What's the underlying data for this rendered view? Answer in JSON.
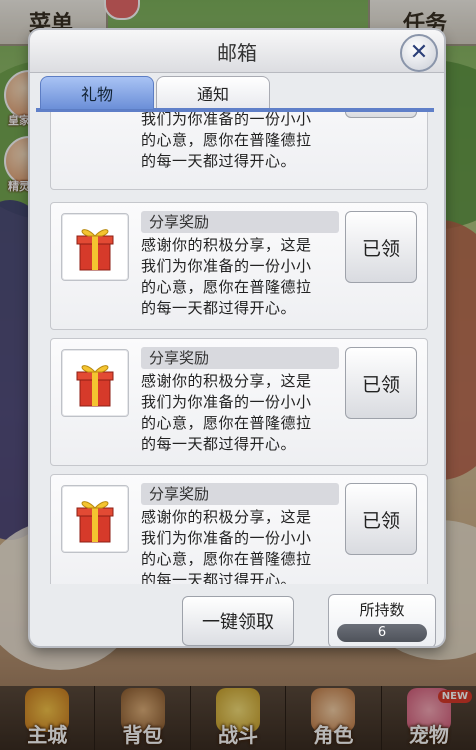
{
  "background": {
    "top_left_menu": "菜单",
    "top_right_task": "任务",
    "side_icons": [
      {
        "label": "皇家"
      },
      {
        "label": "精灵"
      }
    ],
    "bottom_nav": [
      {
        "label": "主城",
        "icon": "castle-icon"
      },
      {
        "label": "背包",
        "icon": "bag-icon"
      },
      {
        "label": "战斗",
        "icon": "battle-icon"
      },
      {
        "label": "角色",
        "icon": "character-icon"
      },
      {
        "label": "宠物",
        "icon": "pet-icon",
        "badge": "NEW"
      }
    ]
  },
  "mailbox": {
    "title": "邮箱",
    "tabs": [
      {
        "label": "礼物",
        "active": true
      },
      {
        "label": "通知",
        "active": false
      }
    ],
    "partial_item": {
      "body_lines": [
        "我们为你准备的一份小小",
        "的心意，愿你在普隆德拉",
        "的每一天都过得开心。"
      ]
    },
    "items": [
      {
        "title": "分享奖励",
        "body_lines": [
          "感谢你的积极分享，这是",
          "我们为你准备的一份小小",
          "的心意，愿你在普隆德拉",
          "的每一天都过得开心。"
        ],
        "button": "已领"
      },
      {
        "title": "分享奖励",
        "body_lines": [
          "感谢你的积极分享，这是",
          "我们为你准备的一份小小",
          "的心意，愿你在普隆德拉",
          "的每一天都过得开心。"
        ],
        "button": "已领"
      },
      {
        "title": "分享奖励",
        "body_lines": [
          "感谢你的积极分享，这是",
          "我们为你准备的一份小小",
          "的心意，愿你在普隆德拉",
          "的每一天都过得开心。"
        ],
        "button": "已领"
      }
    ],
    "claim_all_label": "一键领取",
    "holdings_label": "所持数",
    "holdings_count": "6"
  },
  "colors": {
    "tab_active": "#6b8fd8",
    "modal_bg": "#e9ebee",
    "close_icon": "#2b3f78"
  }
}
